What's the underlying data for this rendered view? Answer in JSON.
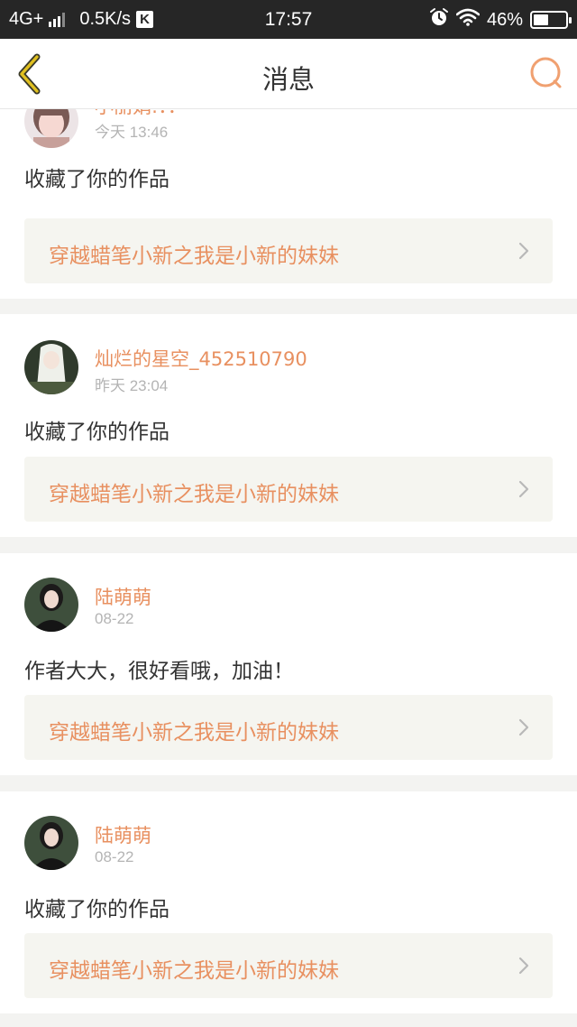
{
  "status_bar": {
    "network": "4G+",
    "speed": "0.5K/s",
    "app_badge": "K",
    "time": "17:57",
    "battery": "46%",
    "battery_level": 0.46,
    "icons": [
      "signal-icon",
      "alarm-icon",
      "wifi-icon",
      "battery-icon"
    ]
  },
  "nav": {
    "title": "消息",
    "back_icon": "back-chevron-icon",
    "search_icon": "search-icon"
  },
  "colors": {
    "accent": "#e89060",
    "back_accent": "#e0c020",
    "text": "#333333",
    "muted": "#b4b4b4",
    "work_bg": "#f5f5f0"
  },
  "messages": [
    {
      "user": "小丽娟:：：",
      "time": "今天 13:46",
      "action": "收藏了你的作品",
      "work_title": "穿越蜡笔小新之我是小新的妹妹"
    },
    {
      "user": "灿烂的星空_452510790",
      "time": "昨天 23:04",
      "action": "收藏了你的作品",
      "work_title": "穿越蜡笔小新之我是小新的妹妹"
    },
    {
      "user": "陆萌萌",
      "time": "08-22",
      "action": "作者大大，很好看哦，加油！",
      "work_title": "穿越蜡笔小新之我是小新的妹妹"
    },
    {
      "user": "陆萌萌",
      "time": "08-22",
      "action": "收藏了你的作品",
      "work_title": "穿越蜡笔小新之我是小新的妹妹"
    }
  ]
}
